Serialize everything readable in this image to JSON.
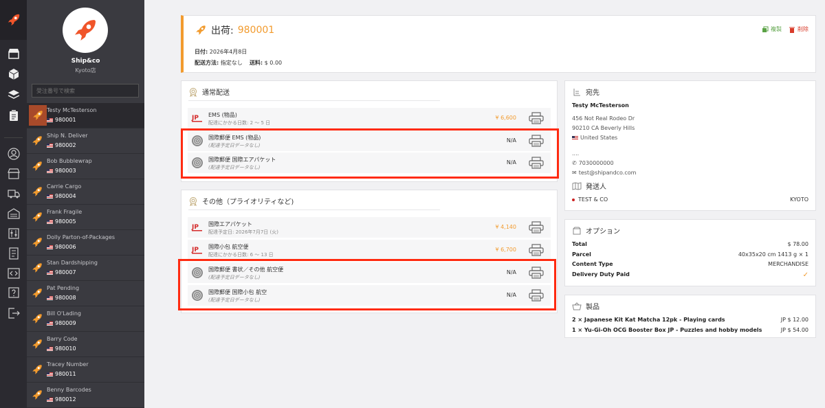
{
  "store": {
    "name": "Ship&co",
    "location": "Kyoto店"
  },
  "search": {
    "placeholder": "受注番号で検索"
  },
  "orders": [
    {
      "name": "Testy McTesterson",
      "number": "980001"
    },
    {
      "name": "Ship N. Deliver",
      "number": "980002"
    },
    {
      "name": "Bob Bubblewrap",
      "number": "980003"
    },
    {
      "name": "Carrie Cargo",
      "number": "980004"
    },
    {
      "name": "Frank Fragile",
      "number": "980005"
    },
    {
      "name": "Dolly Parton-of-Packages",
      "number": "980006"
    },
    {
      "name": "Stan Dardshipping",
      "number": "980007"
    },
    {
      "name": "Pat Pending",
      "number": "980008"
    },
    {
      "name": "Bill O'Lading",
      "number": "980009"
    },
    {
      "name": "Barry Code",
      "number": "980010"
    },
    {
      "name": "Tracey Number",
      "number": "980011"
    },
    {
      "name": "Benny Barcodes",
      "number": "980012"
    }
  ],
  "shipment": {
    "title_label": "出荷:",
    "number": "980001",
    "date_label": "日付:",
    "date": "2026年4月8日",
    "method_label": "配送方法:",
    "method": "指定なし",
    "fee_label": "送料:",
    "fee": "$ 0.00",
    "copy_label": "複製",
    "delete_label": "削除"
  },
  "normal_shipping": {
    "title": "通常配送",
    "rates": [
      {
        "name": "EMS (物品)",
        "sub": "配達にかかる日数: 2 〜 5 日",
        "price": "¥ 6,600"
      },
      {
        "name": "国際郵便 EMS (物品)",
        "sub": "(配達予定日データなし)",
        "price": "N/A"
      },
      {
        "name": "国際郵便 国際エアパケット",
        "sub": "(配達予定日データなし)",
        "price": "N/A"
      }
    ]
  },
  "other_shipping": {
    "title": "その他（プライオリティなど)",
    "rates": [
      {
        "name": "国際エアパケット",
        "sub": "配達予定日: 2026年7月7日 (火)",
        "price": "¥ 4,140"
      },
      {
        "name": "国際小包 航空便",
        "sub": "配達にかかる日数: 6 〜 13 日",
        "price": "¥ 6,700"
      },
      {
        "name": "国際郵便 書状／その他 航空便",
        "sub": "(配達予定日データなし)",
        "price": "N/A"
      },
      {
        "name": "国際郵便 国際小包 航空",
        "sub": "(配達予定日データなし)",
        "price": "N/A"
      }
    ]
  },
  "recipient": {
    "title": "宛先",
    "name": "Testy McTesterson",
    "address1": "456 Not Real Rodeo Dr",
    "address2": "90210 CA Beverly Hills",
    "country": "United States",
    "dots": "....",
    "phone": "7030000000",
    "email": "test@shipandco.com"
  },
  "sender": {
    "title": "発送人",
    "name": "TEST & CO",
    "city": "KYOTO"
  },
  "options": {
    "title": "オプション",
    "rows": [
      {
        "key": "Total",
        "value": "$ 78.00"
      },
      {
        "key": "Parcel",
        "value": "40x35x20 cm 1413 g × 1"
      },
      {
        "key": "Content Type",
        "value": "MERCHANDISE"
      },
      {
        "key": "Delivery Duty Paid",
        "value": ""
      }
    ]
  },
  "products": {
    "title": "製品",
    "items": [
      {
        "name": "2 × Japanese Kit Kat Matcha 12pk - Playing cards",
        "price": "JP $ 12.00"
      },
      {
        "name": "1 × Yu-Gi-Oh OCG Booster Box JP - Puzzles and hobby models",
        "price": "JP $ 54.00"
      }
    ]
  },
  "colors": {
    "accent": "#f29b2e",
    "highlight": "#ff2a10",
    "sidebar": "#3a3a40",
    "rail": "#2b2a30"
  }
}
